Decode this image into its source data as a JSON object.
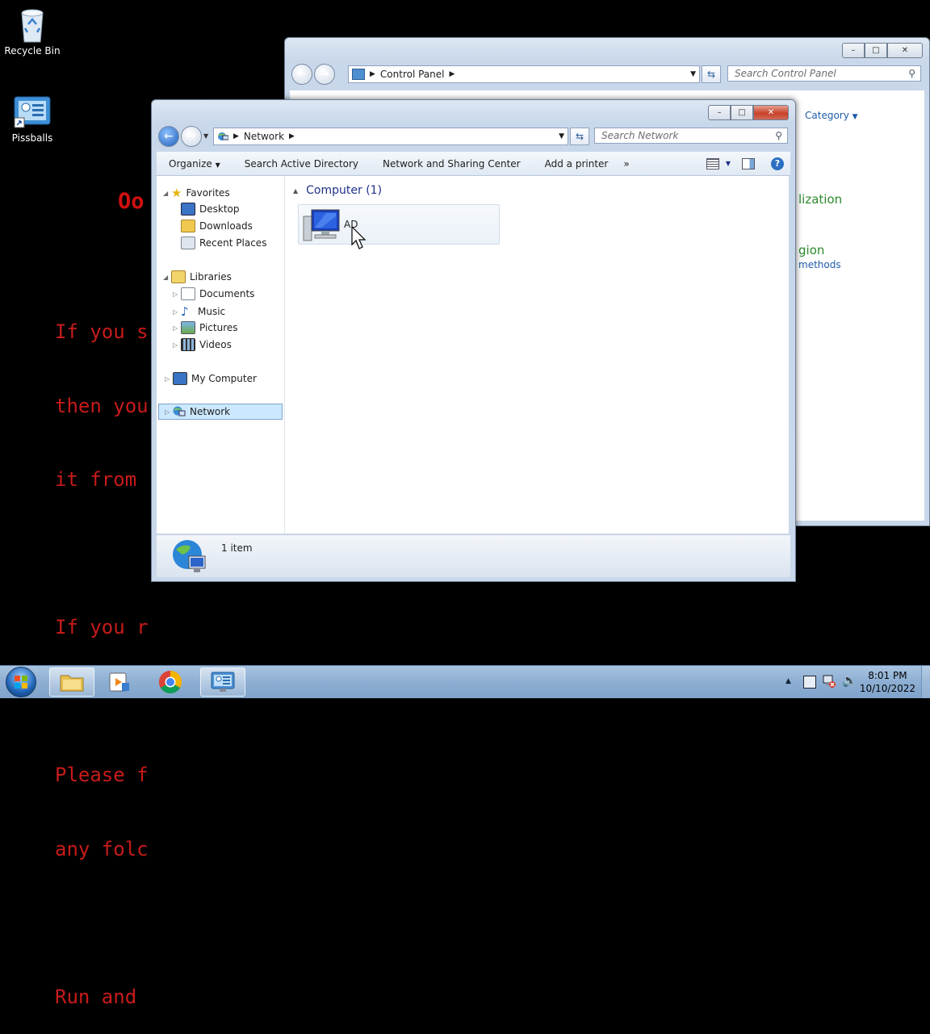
{
  "desktop": {
    "icons": [
      {
        "label": "Recycle Bin",
        "icon": "recycle-bin-icon"
      },
      {
        "label": "Pissballs",
        "icon": "control-panel-shortcut-icon"
      }
    ],
    "ransom_note": {
      "title_fragment": "Oo",
      "lines": [
        "If you s",
        "then you",
        "it from",
        "",
        "If you r",
        "",
        "Please f",
        "any folc",
        "",
        "Run and"
      ]
    }
  },
  "control_panel": {
    "address": {
      "crumb": "Control Panel"
    },
    "search_placeholder": "Search Control Panel",
    "view_by": "Category",
    "partial_texts": [
      "lization",
      "gion",
      "methods"
    ],
    "caption_buttons": {
      "minimize": "–",
      "maximize": "□",
      "close": "✕"
    }
  },
  "network_window": {
    "address": {
      "crumb": "Network"
    },
    "search_placeholder": "Search Network",
    "toolbar": {
      "organize": "Organize",
      "search_ad": "Search Active Directory",
      "sharing_center": "Network and Sharing Center",
      "add_printer": "Add a printer",
      "more": "»"
    },
    "nav": {
      "favorites": "Favorites",
      "desktop": "Desktop",
      "downloads": "Downloads",
      "recent_places": "Recent Places",
      "libraries": "Libraries",
      "documents": "Documents",
      "music": "Music",
      "pictures": "Pictures",
      "videos": "Videos",
      "my_computer": "My Computer",
      "network": "Network"
    },
    "group_header": "Computer (1)",
    "items": [
      {
        "name": "AD",
        "icon": "computer-icon"
      }
    ],
    "status": "1 item",
    "caption_buttons": {
      "minimize": "–",
      "maximize": "□",
      "close": "✕"
    }
  },
  "taskbar": {
    "time": "8:01 PM",
    "date": "10/10/2022",
    "pinned": [
      "start-orb-icon",
      "explorer-icon",
      "media-player-icon",
      "chrome-icon",
      "control-panel-icon"
    ]
  },
  "colors": {
    "ransom_text": "#c71b1b",
    "selection": "#cce8ff",
    "link_blue": "#1e5ca8",
    "cp_green": "#2b8a2b"
  }
}
